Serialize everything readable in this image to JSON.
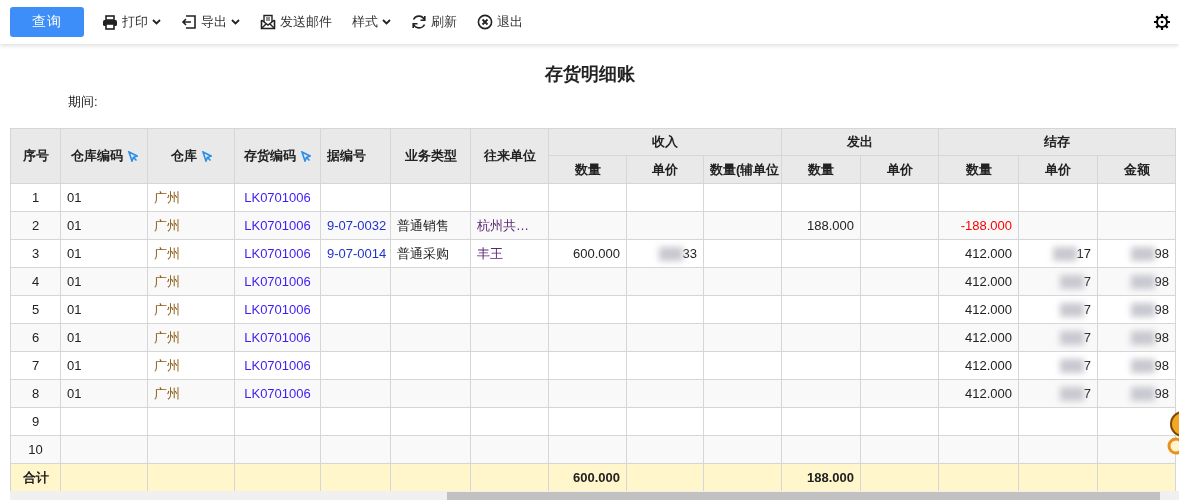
{
  "toolbar": [
    {
      "label": "查询",
      "kind": "primary",
      "dropdown": false
    },
    {
      "label": "打印",
      "kind": "action",
      "dropdown": true
    },
    {
      "label": "导出",
      "kind": "action",
      "dropdown": true
    },
    {
      "label": "发送邮件",
      "kind": "action",
      "dropdown": false
    },
    {
      "label": "样式",
      "kind": "action",
      "dropdown": true
    },
    {
      "label": "刷新",
      "kind": "action",
      "dropdown": false
    },
    {
      "label": "退出",
      "kind": "action",
      "dropdown": false
    }
  ],
  "title": "存货明细账",
  "period_label": "期间:",
  "table": {
    "header": [
      {
        "label": "序号",
        "pinned": false
      },
      {
        "label": "仓库编码",
        "pinned": true
      },
      {
        "label": "仓库",
        "pinned": true
      },
      {
        "label": "存货编码",
        "pinned": true
      },
      {
        "label": "据编号",
        "pinned": false
      },
      {
        "label": "业务类型",
        "pinned": false
      },
      {
        "label": "往来单位",
        "pinned": false
      },
      {
        "label": "收入",
        "children": [
          {
            "label": "数量"
          },
          {
            "label": "单价"
          },
          {
            "label": "数量(辅单位"
          }
        ]
      },
      {
        "label": "发出",
        "children": [
          {
            "label": "数量"
          },
          {
            "label": "单价"
          }
        ]
      },
      {
        "label": "结存",
        "children": [
          {
            "label": "数量"
          },
          {
            "label": "单价"
          },
          {
            "label": "金额"
          }
        ]
      }
    ],
    "rows": [
      {
        "no": "1",
        "warehouse_code": "01",
        "warehouse": "广州",
        "item_code": "LK0701006"
      },
      {
        "no": "2",
        "warehouse_code": "01",
        "warehouse": "广州",
        "item_code": "LK0701006",
        "doc_no": "9-07-0032",
        "biz_type": "普通销售",
        "partner": "杭州共…",
        "out_qty": "188.000",
        "bal_qty": "-188.000",
        "masked": false,
        "balance_negative": true
      },
      {
        "no": "3",
        "warehouse_code": "01",
        "warehouse": "广州",
        "item_code": "LK0701006",
        "doc_no": "9-07-0014",
        "biz_type": "普通采购",
        "partner": "丰王",
        "in_qty": "600.000",
        "in_price": "33",
        "bal_qty": "412.000",
        "bal_price": "17",
        "bal_amount": "98",
        "masked": true,
        "balance_negative": false
      },
      {
        "no": "4",
        "warehouse_code": "01",
        "warehouse": "广州",
        "item_code": "LK0701006",
        "bal_qty": "412.000",
        "bal_price": "7",
        "bal_amount": "98",
        "masked": true,
        "balance_negative": false
      },
      {
        "no": "5",
        "warehouse_code": "01",
        "warehouse": "广州",
        "item_code": "LK0701006",
        "bal_qty": "412.000",
        "bal_price": "7",
        "bal_amount": "98",
        "masked": true,
        "balance_negative": false
      },
      {
        "no": "6",
        "warehouse_code": "01",
        "warehouse": "广州",
        "item_code": "LK0701006",
        "bal_qty": "412.000",
        "bal_price": "7",
        "bal_amount": "98",
        "masked": true,
        "balance_negative": false
      },
      {
        "no": "7",
        "warehouse_code": "01",
        "warehouse": "广州",
        "item_code": "LK0701006",
        "bal_qty": "412.000",
        "bal_price": "7",
        "bal_amount": "98",
        "masked": true,
        "balance_negative": false
      },
      {
        "no": "8",
        "warehouse_code": "01",
        "warehouse": "广州",
        "item_code": "LK0701006",
        "bal_qty": "412.000",
        "bal_price": "7",
        "bal_amount": "98",
        "masked": true,
        "balance_negative": false
      },
      {
        "no": "9"
      },
      {
        "no": "10"
      }
    ],
    "totals": {
      "label": "合计",
      "in_qty": "600.000",
      "out_qty": "188.000"
    }
  }
}
